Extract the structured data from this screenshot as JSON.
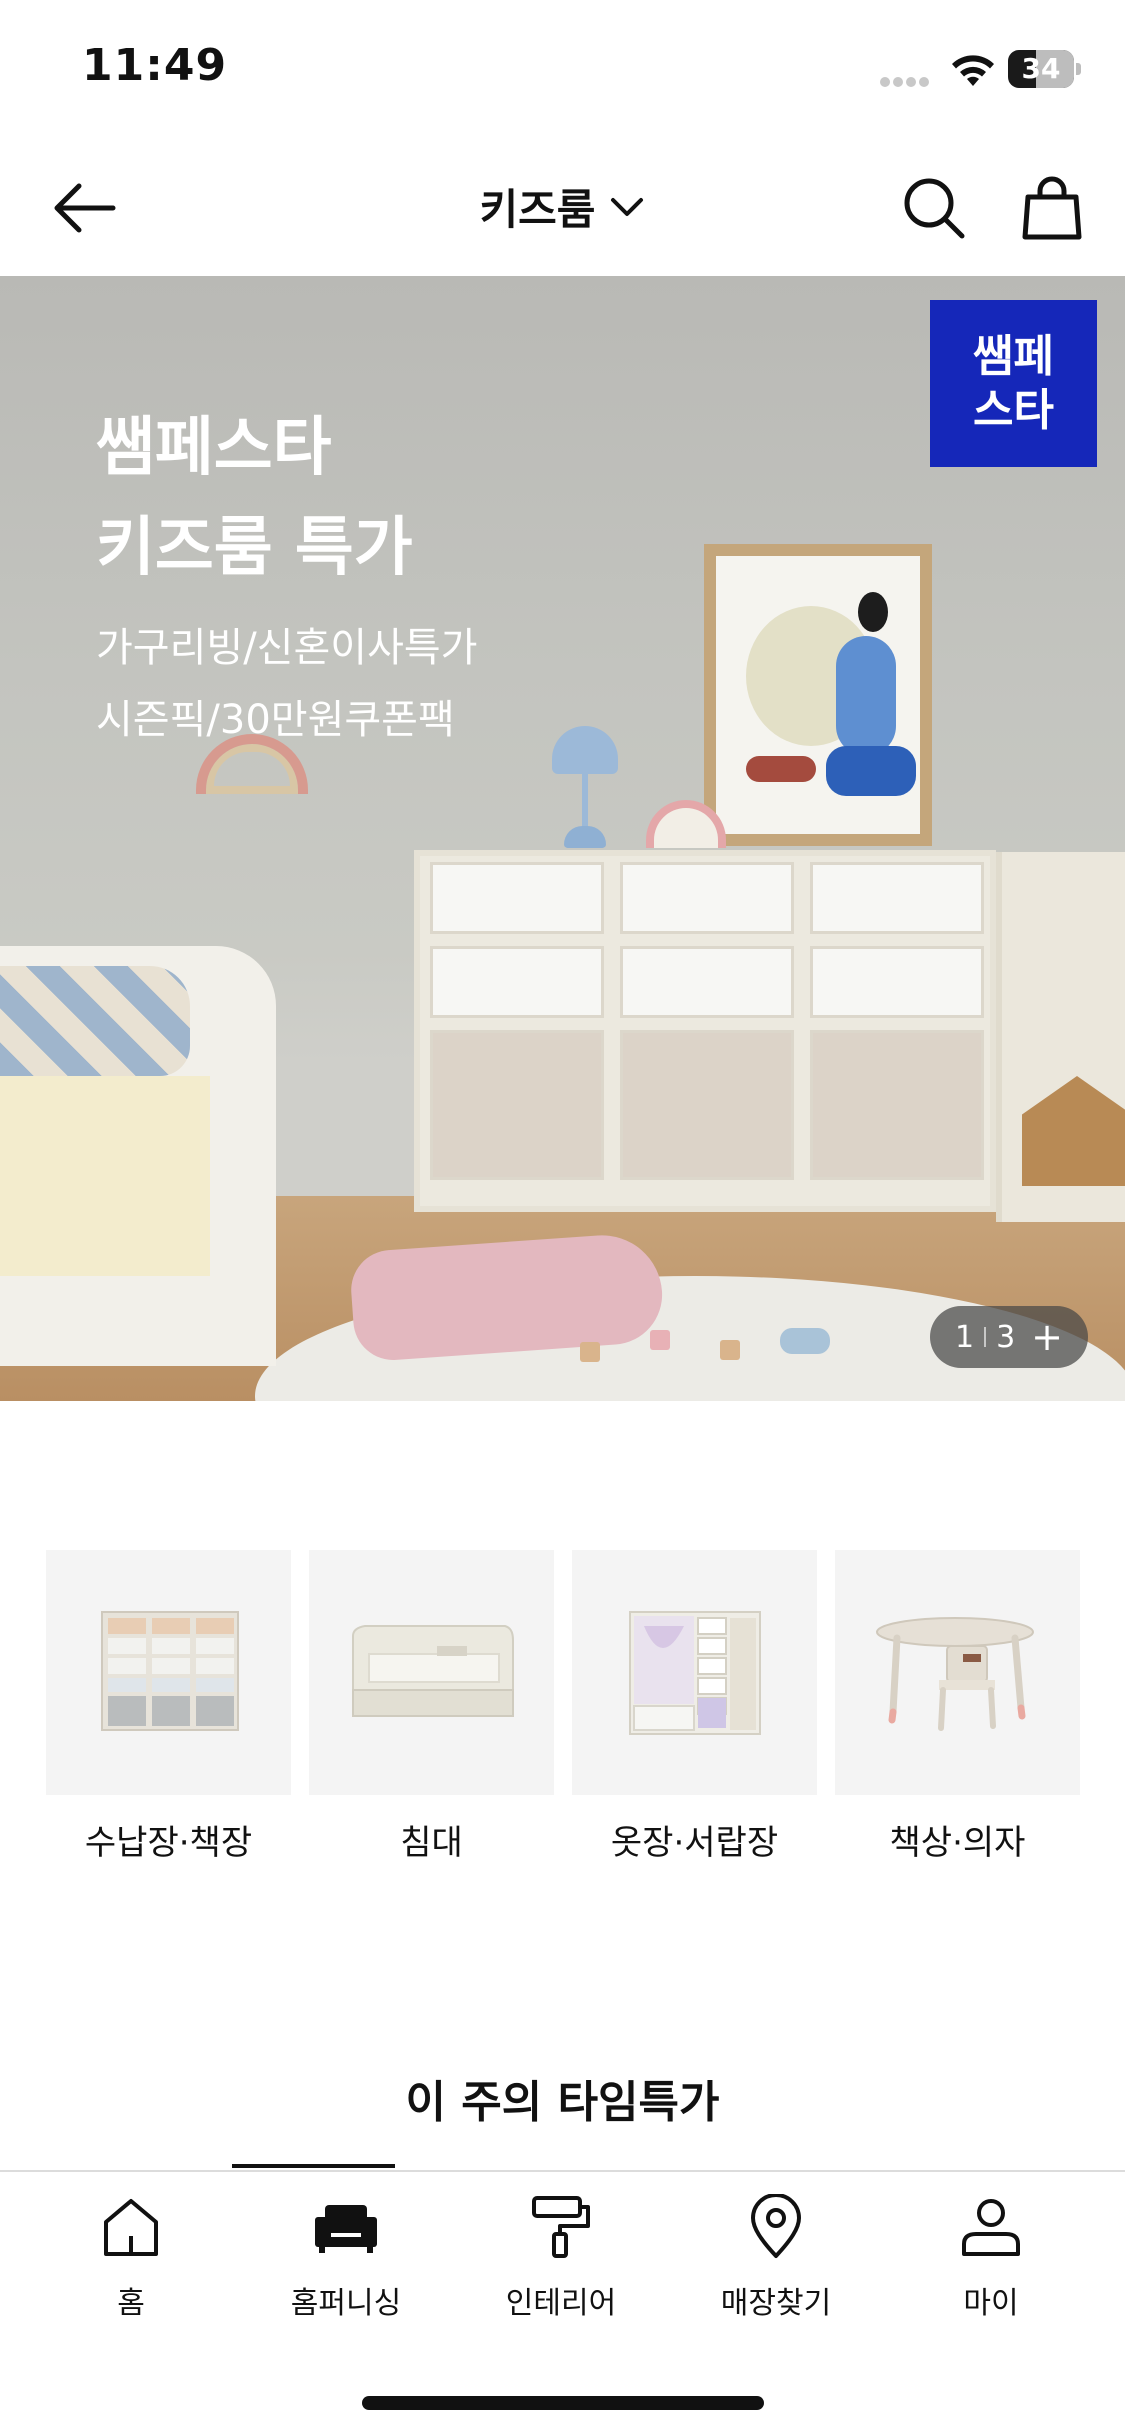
{
  "status": {
    "time": "11:49",
    "battery": "34"
  },
  "header": {
    "title": "키즈룸"
  },
  "hero": {
    "title_line1": "쌤페스타",
    "title_line2": "키즈룸 특가",
    "sub_line1": "가구리빙/신혼이사특가",
    "sub_line2": "시즌픽/30만원쿠폰팩",
    "badge_line1": "쌤페",
    "badge_line2": "스타",
    "counter_current": "1",
    "counter_total": "3"
  },
  "categories": [
    {
      "label": "수납장·책장",
      "icon": "storage-cabinet"
    },
    {
      "label": "침대",
      "icon": "kids-bed"
    },
    {
      "label": "옷장·서랍장",
      "icon": "wardrobe"
    },
    {
      "label": "책상·의자",
      "icon": "desk-chair"
    }
  ],
  "weekly": {
    "title": "이 주의 타임특가"
  },
  "bottom_nav": [
    {
      "label": "홈",
      "icon": "home-icon"
    },
    {
      "label": "홈퍼니싱",
      "icon": "sofa-icon",
      "active": true
    },
    {
      "label": "인테리어",
      "icon": "paint-roller-icon"
    },
    {
      "label": "매장찾기",
      "icon": "location-pin-icon"
    },
    {
      "label": "마이",
      "icon": "person-icon"
    }
  ]
}
